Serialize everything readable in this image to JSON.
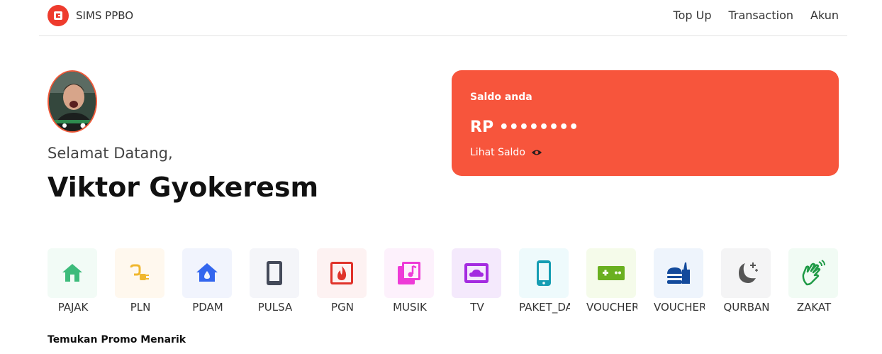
{
  "navbar": {
    "brand": "SIMS PPBO",
    "links": [
      "Top Up",
      "Transaction",
      "Akun"
    ]
  },
  "profile": {
    "greeting": "Selamat Datang,",
    "name": "Viktor Gyokeresm"
  },
  "balance": {
    "label": "Saldo anda",
    "value": "RP ••••••••",
    "toggle_label": "Lihat Saldo"
  },
  "services": [
    {
      "label": "PAJAK",
      "icon": "house-icon",
      "color": "#3dbb7b",
      "bg": "#f2fbf6"
    },
    {
      "label": "PLN",
      "icon": "plug-icon",
      "color": "#f0b72f",
      "bg": "#fff8ee"
    },
    {
      "label": "PDAM",
      "icon": "water-house-icon",
      "color": "#3366ee",
      "bg": "#f1f4fd"
    },
    {
      "label": "PULSA",
      "icon": "phone-icon",
      "color": "#444a5a",
      "bg": "#f4f5f9"
    },
    {
      "label": "PGN",
      "icon": "fire-icon",
      "color": "#e0322a",
      "bg": "#fdf2f2"
    },
    {
      "label": "MUSIK",
      "icon": "music-library-icon",
      "color": "#ee3bd7",
      "bg": "#fdf1fc"
    },
    {
      "label": "TV",
      "icon": "tv-cloud-icon",
      "color": "#a42be0",
      "bg": "#f4e9fc"
    },
    {
      "label": "PAKET_DATA",
      "icon": "smartphone-icon",
      "color": "#169db3",
      "bg": "#eefafc"
    },
    {
      "label": "VOUCHER",
      "icon": "gamepad-icon",
      "color": "#6ab020",
      "bg": "#f5fbea"
    },
    {
      "label": "VOUCHER",
      "icon": "food-icon",
      "color": "#134a9c",
      "bg": "#eef4fc"
    },
    {
      "label": "QURBAN",
      "icon": "moon-star-icon",
      "color": "#555555",
      "bg": "#f4f4f5"
    },
    {
      "label": "ZAKAT",
      "icon": "clap-hands-icon",
      "color": "#1f9a46",
      "bg": "#f1fbf4"
    }
  ],
  "promo": {
    "title": "Temukan Promo Menarik"
  }
}
